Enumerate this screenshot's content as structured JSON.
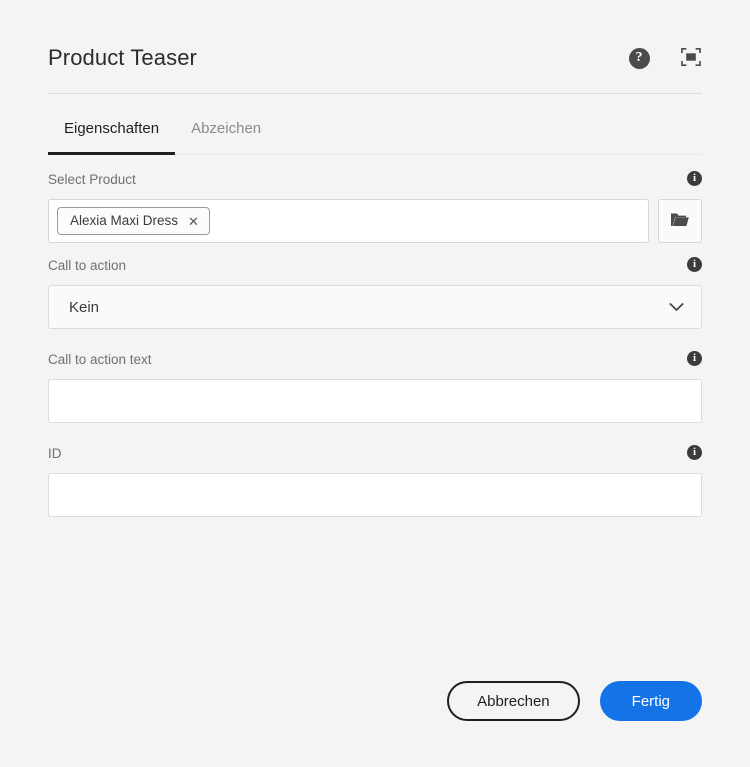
{
  "dialog": {
    "title": "Product Teaser",
    "header_actions": [
      {
        "name": "help-icon",
        "glyph": "?",
        "label": "Help"
      },
      {
        "name": "fullscreen-icon",
        "label": "Fullscreen"
      }
    ]
  },
  "tabs": [
    {
      "label": "Eigenschaften",
      "active": true
    },
    {
      "label": "Abzeichen",
      "active": false
    }
  ],
  "fields": {
    "select_product": {
      "label": "Select Product",
      "info": "i",
      "chip": {
        "text": "Alexia Maxi Dress",
        "remove": "✕"
      },
      "browse_label": "Browse"
    },
    "call_to_action": {
      "label": "Call to action",
      "info": "i",
      "value": "Kein",
      "options": [
        "Kein"
      ]
    },
    "call_to_action_text": {
      "label": "Call to action text",
      "info": "i",
      "value": "",
      "placeholder": ""
    },
    "id": {
      "label": "ID",
      "info": "i",
      "value": "",
      "placeholder": ""
    }
  },
  "footer": {
    "cancel_label": "Abbrechen",
    "done_label": "Fertig"
  },
  "colors": {
    "background": "#f4f4f4",
    "accent": "#1473e6",
    "text": "#2c2c2c",
    "label": "#707070",
    "border": "#dcdcdc",
    "tab_active": "#1f1f1f"
  }
}
